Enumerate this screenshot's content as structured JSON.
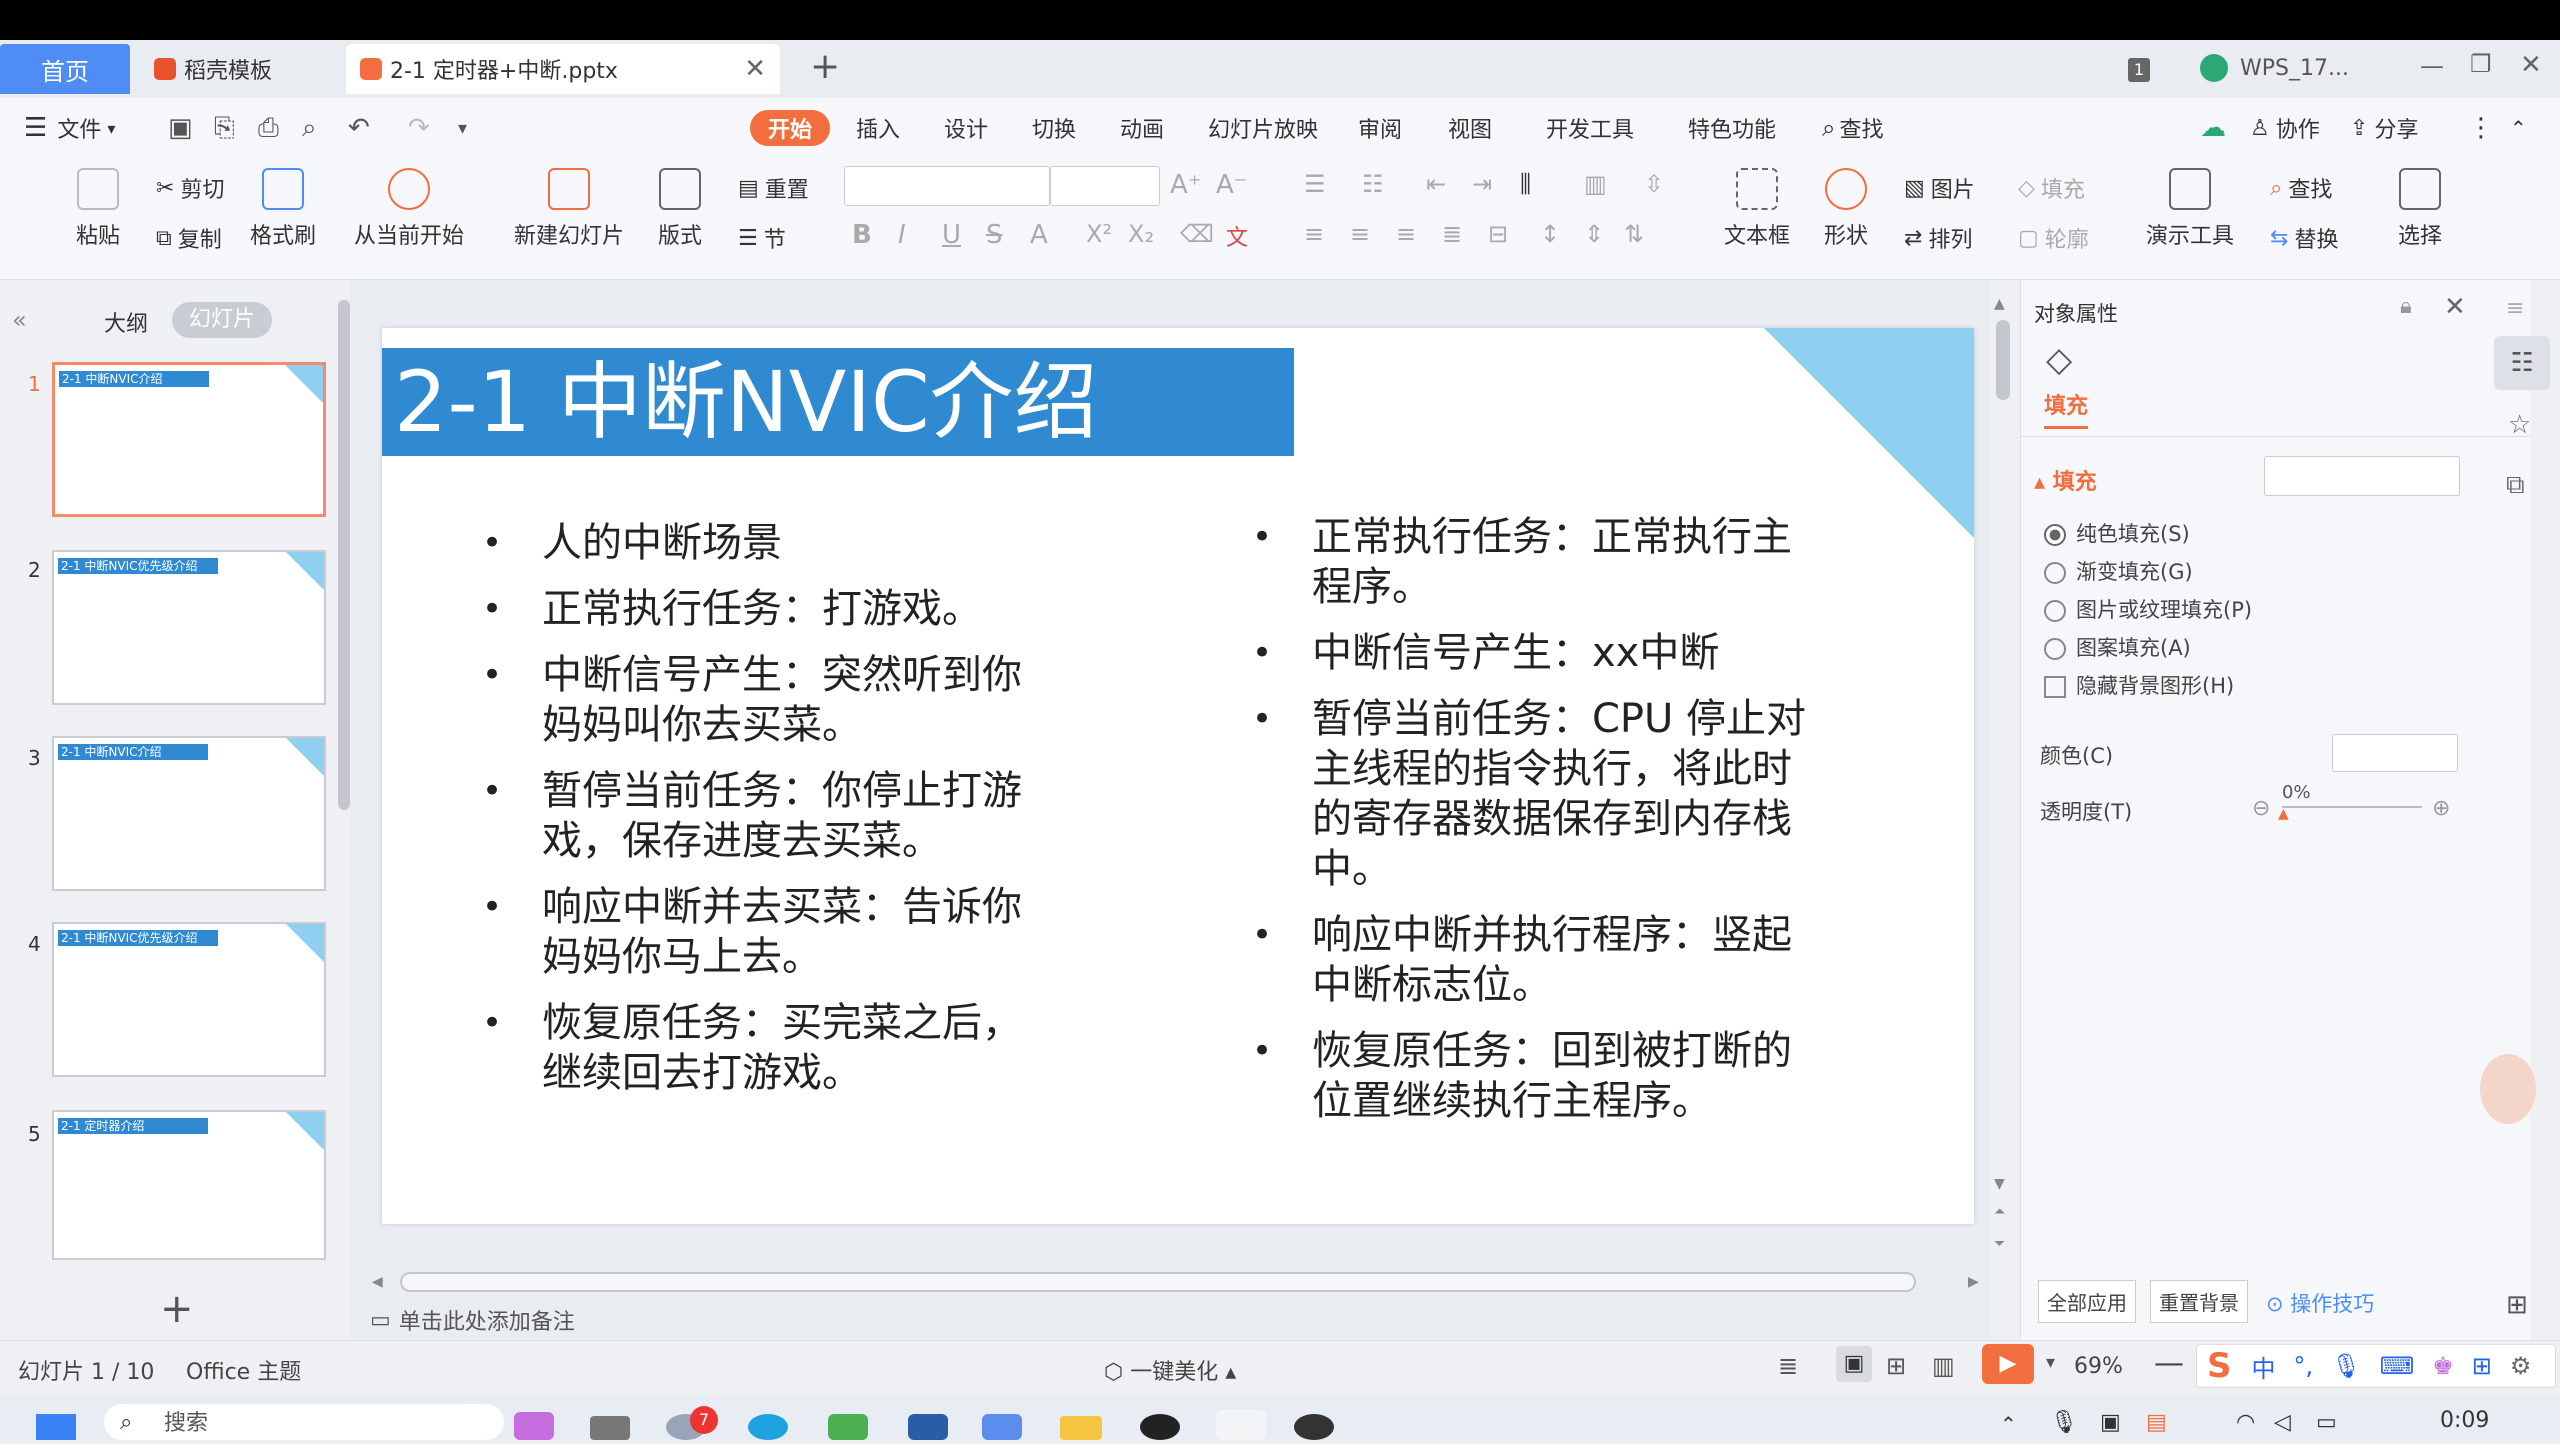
{
  "tabs": {
    "home": "首页",
    "template": "稻壳模板",
    "doc": "2-1 定时器+中断.pptx",
    "add": "+",
    "count": "1",
    "account": "WPS_17..."
  },
  "menu": {
    "file": "文件",
    "items": [
      "开始",
      "插入",
      "设计",
      "切换",
      "动画",
      "幻灯片放映",
      "审阅",
      "视图",
      "开发工具",
      "特色功能"
    ],
    "search": "查找",
    "collab": "协作",
    "share": "分享"
  },
  "ribbon": {
    "paste": "粘贴",
    "cut": "剪切",
    "copy": "复制",
    "format_painter": "格式刷",
    "play_from_current": "从当前开始",
    "new_slide": "新建幻灯片",
    "layout": "版式",
    "reset": "重置",
    "section": "节",
    "textbox": "文本框",
    "shape": "形状",
    "picture": "图片",
    "arrange": "排列",
    "fill": "填充",
    "outline": "轮廓",
    "present_tools": "演示工具",
    "find": "查找",
    "replace": "替换",
    "select": "选择"
  },
  "leftpane": {
    "outline_tab": "大纲",
    "slides_tab": "幻灯片",
    "add": "+",
    "thumbs": [
      {
        "num": "1",
        "title": "2-1 中断NVIC介绍"
      },
      {
        "num": "2",
        "title": "2-1 中断NVIC优先级介绍"
      },
      {
        "num": "3",
        "title": "2-1 中断NVIC介绍"
      },
      {
        "num": "4",
        "title": "2-1 中断NVIC优先级介绍"
      },
      {
        "num": "5",
        "title": "2-1 定时器介绍"
      }
    ]
  },
  "slide": {
    "title": "2-1 中断NVIC介绍",
    "left_bullets": [
      "人的中断场景",
      "正常执行任务：打游戏。",
      "中断信号产生：突然听到你妈妈叫你去买菜。",
      "暂停当前任务：你停止打游戏，保存进度去买菜。",
      "响应中断并去买菜：告诉你妈妈你马上去。",
      "恢复原任务：买完菜之后，继续回去打游戏。"
    ],
    "right_bullets": [
      "正常执行任务：正常执行主程序。",
      "中断信号产生：xx中断",
      "暂停当前任务：CPU 停止对主线程的指令执行，将此时的寄存器数据保存到内存栈中。",
      "响应中断并执行程序：竖起中断标志位。",
      "恢复原任务：回到被打断的位置继续执行主程序。"
    ]
  },
  "notes": "单击此处添加备注",
  "rightpane": {
    "title": "对象属性",
    "fill_tab": "填充",
    "fill_section": "填充",
    "options": [
      "纯色填充(S)",
      "渐变填充(G)",
      "图片或纹理填充(P)",
      "图案填充(A)"
    ],
    "hide_bg": "隐藏背景图形(H)",
    "color_label": "颜色(C)",
    "transparency_label": "透明度(T)",
    "transparency_value": "0%",
    "apply_all": "全部应用",
    "reset_bg": "重置背景",
    "tips": "操作技巧"
  },
  "status": {
    "slide_info": "幻灯片 1 / 10",
    "theme": "Office 主题",
    "beautify": "一键美化",
    "zoom": "69%"
  },
  "taskbar": {
    "search": "搜索",
    "badge": "7",
    "ime": "中",
    "time": "0:09"
  },
  "colors": {
    "accent": "#f26e3f",
    "title_bar": "#2f8ad2",
    "triangle": "#8fd0f0",
    "home_tab": "#4f8df5"
  }
}
